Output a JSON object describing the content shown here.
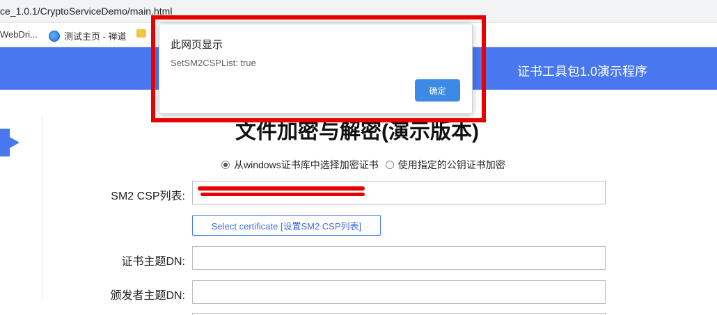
{
  "browser": {
    "url": "ce_1.0.1/CryptoServiceDemo/main.html",
    "bookmarks": [
      {
        "label": "WebDri...",
        "icon": "none"
      },
      {
        "label": "测试主页 - 禅道",
        "icon": "globe-icon"
      },
      {
        "label": "",
        "icon": "folder-icon"
      }
    ]
  },
  "header": {
    "title": "证书工具包1.0演示程序",
    "color": "#4877f0"
  },
  "main": {
    "title": "文件加密与解密(演示版本)",
    "radio_options": [
      {
        "label": "从windows证书库中选择加密证书",
        "checked": true
      },
      {
        "label": "使用指定的公钥证书加密",
        "checked": false
      }
    ],
    "fields": {
      "csp_list_label": "SM2 CSP列表:",
      "csp_list_value": "",
      "select_cert_label": "Select certificate [设置SM2 CSP列表]",
      "subject_dn_label": "证书主题DN:",
      "issuer_dn_label": "颁发者主题DN:"
    }
  },
  "dialog": {
    "title": "此网页显示",
    "message": "SetSM2CSPList: true",
    "ok_label": "确定",
    "button_color": "#3d8ae6",
    "highlight_color": "#e60000"
  }
}
